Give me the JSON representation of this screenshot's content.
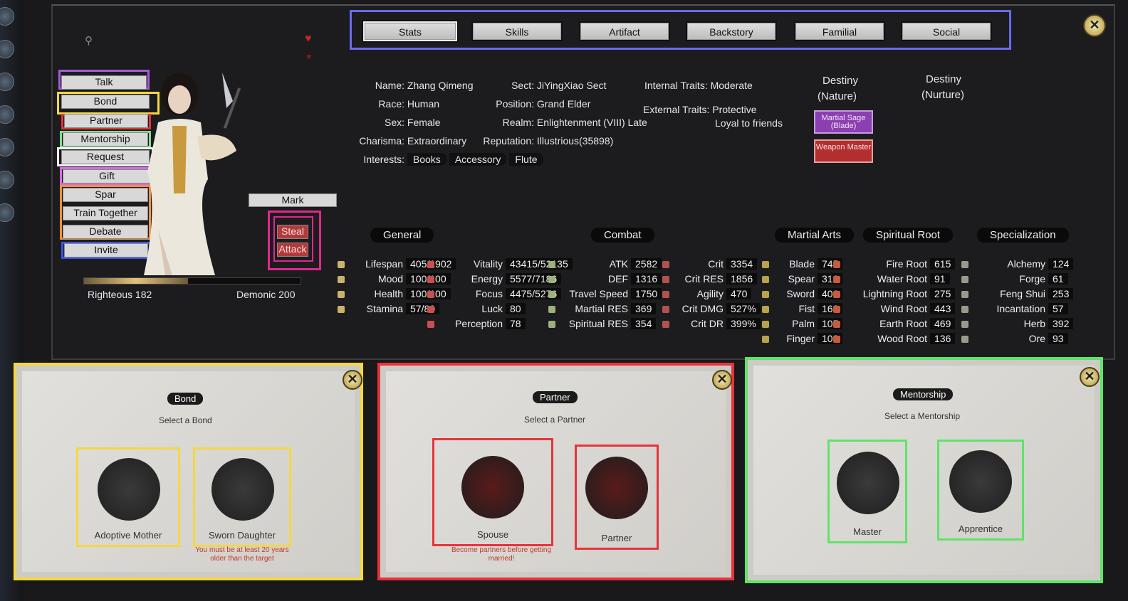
{
  "tabs": [
    "Stats",
    "Skills",
    "Artifact",
    "Backstory",
    "Familial",
    "Social"
  ],
  "actions": [
    "Talk",
    "Bond",
    "Partner",
    "Mentorship",
    "Request",
    "Gift",
    "Spar",
    "Train Together",
    "Debate",
    "Invite"
  ],
  "mark_label": "Mark",
  "steal_label": "Steal",
  "attack_label": "Attack",
  "alignment": {
    "righteous": "Righteous 182",
    "demonic": "Demonic 200",
    "fill_fraction": 0.48
  },
  "info": {
    "name": "Name:",
    "name_v": "Zhang Qimeng",
    "race": "Race:",
    "race_v": "Human",
    "sex": "Sex:",
    "sex_v": "Female",
    "charisma": "Charisma:",
    "charisma_v": "Extraordinary",
    "interests": "Interests:",
    "interests_v": [
      "Books",
      "Accessory",
      "Flute"
    ],
    "sect": "Sect:",
    "sect_v": "JiYingXiao Sect",
    "position": "Position:",
    "position_v": "Grand Elder",
    "realm": "Realm:",
    "realm_v": "Enlightenment (VIII) Late",
    "reputation": "Reputation:",
    "reputation_v": "Illustrious(35898)",
    "internal": "Internal Traits:",
    "internal_v": "Moderate",
    "external": "External Traits:",
    "external_v1": "Protective",
    "external_v2": "Loyal to friends"
  },
  "destiny": {
    "nature_1": "Destiny",
    "nature_2": "(Nature)",
    "nurture_1": "Destiny",
    "nurture_2": "(Nurture)",
    "badge1": "Martial Sage (Blade)",
    "badge2": "Weapon Master"
  },
  "categories": [
    "General",
    "Combat",
    "Martial Arts",
    "Spiritual Root",
    "Specialization"
  ],
  "general_a": [
    [
      "Lifespan",
      "405/1902"
    ],
    [
      "Mood",
      "100/100"
    ],
    [
      "Health",
      "100/100"
    ],
    [
      "Stamina",
      "57/80"
    ]
  ],
  "general_b": [
    [
      "Vitality",
      "43415/52135"
    ],
    [
      "Energy",
      "5577/7186"
    ],
    [
      "Focus",
      "4475/5276"
    ],
    [
      "Luck",
      "80"
    ],
    [
      "Perception",
      "78"
    ]
  ],
  "combat_a": [
    [
      "ATK",
      "2582"
    ],
    [
      "DEF",
      "1316"
    ],
    [
      "Travel Speed",
      "1750"
    ],
    [
      "Martial RES",
      "369"
    ],
    [
      "Spiritual RES",
      "354"
    ]
  ],
  "combat_b": [
    [
      "Crit",
      "3354"
    ],
    [
      "Crit RES",
      "1856"
    ],
    [
      "Agility",
      "470"
    ],
    [
      "Crit DMG",
      "527%"
    ],
    [
      "Crit DR",
      "399%"
    ]
  ],
  "martial": [
    [
      "Blade",
      "745"
    ],
    [
      "Spear",
      "316"
    ],
    [
      "Sword",
      "406"
    ],
    [
      "Fist",
      "168"
    ],
    [
      "Palm",
      "105"
    ],
    [
      "Finger",
      "108"
    ]
  ],
  "roots": [
    [
      "Fire Root",
      "615"
    ],
    [
      "Water Root",
      "91"
    ],
    [
      "Lightning Root",
      "275"
    ],
    [
      "Wind Root",
      "443"
    ],
    [
      "Earth Root",
      "469"
    ],
    [
      "Wood Root",
      "136"
    ]
  ],
  "spec": [
    [
      "Alchemy",
      "124"
    ],
    [
      "Forge",
      "61"
    ],
    [
      "Feng Shui",
      "253"
    ],
    [
      "Incantation",
      "57"
    ],
    [
      "Herb",
      "392"
    ],
    [
      "Ore",
      "93"
    ]
  ],
  "panels": {
    "bond": {
      "title": "Bond",
      "subtitle": "Select a Bond",
      "opt1": "Adoptive Mother",
      "opt2": "Sworn Daughter",
      "warn": "You must be at least 20 years older than the target"
    },
    "partner": {
      "title": "Partner",
      "subtitle": "Select a Partner",
      "opt1": "Spouse",
      "opt2": "Partner",
      "warn": "Become partners before getting married!"
    },
    "mentor": {
      "title": "Mentorship",
      "subtitle": "Select a Mentorship",
      "opt1": "Master",
      "opt2": "Apprentice"
    }
  },
  "colors": {
    "accent_blue": "#6a6af0",
    "yellow": "#f5d742",
    "red": "#e8323c",
    "green": "#5fe36a",
    "magenta": "#e0288c"
  }
}
